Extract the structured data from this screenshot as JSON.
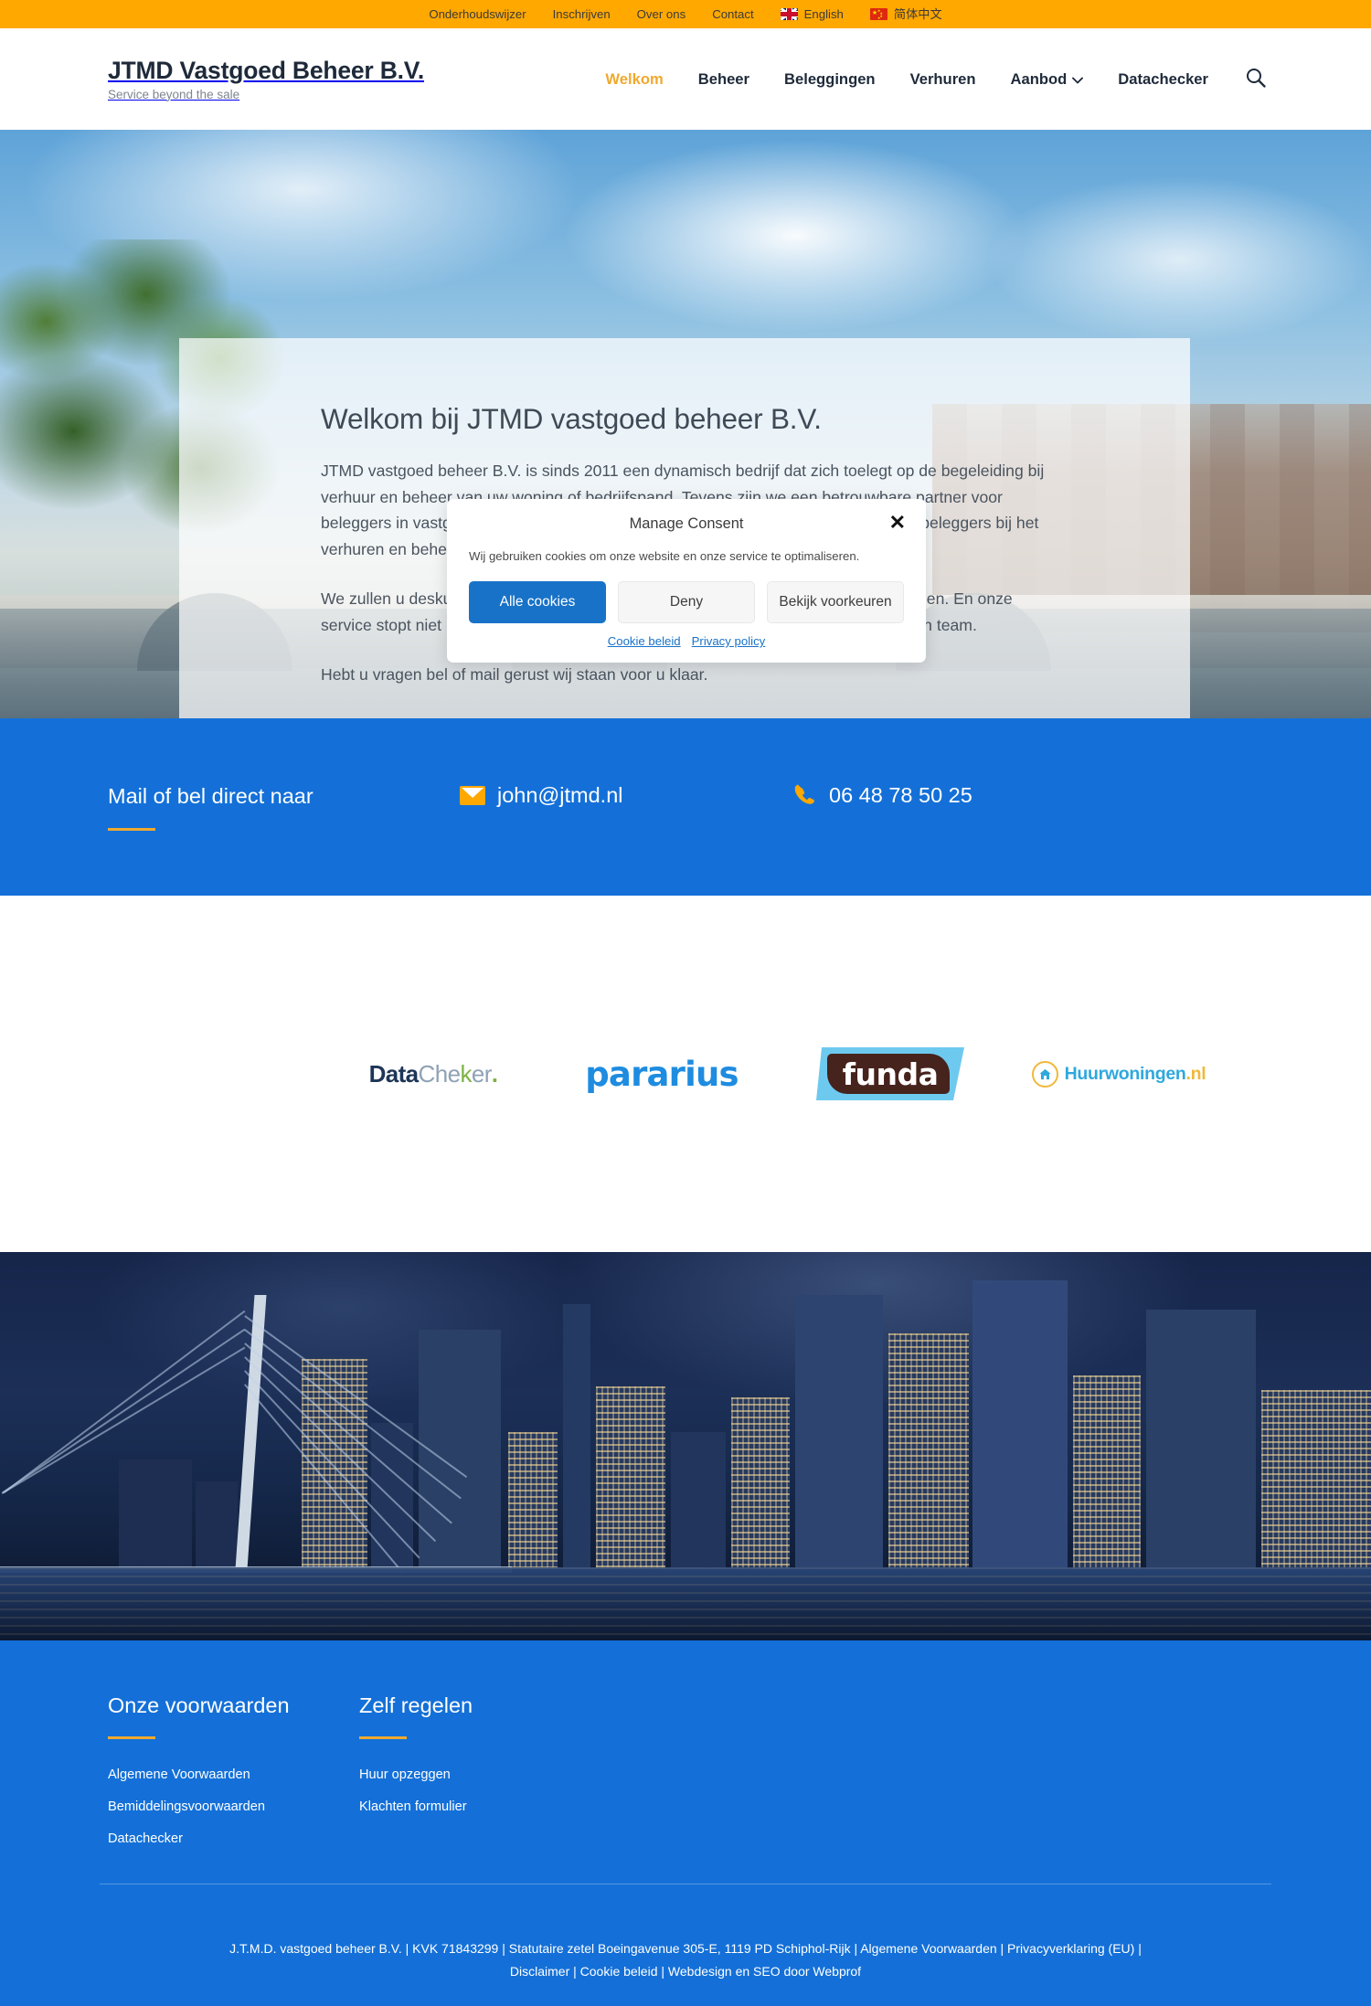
{
  "topbar": {
    "links": [
      {
        "label": "Onderhoudswijzer"
      },
      {
        "label": "Inschrijven"
      },
      {
        "label": "Over ons"
      },
      {
        "label": "Contact"
      }
    ],
    "languages": [
      {
        "label": "English",
        "flag": "uk-flag-icon"
      },
      {
        "label": "简体中文",
        "flag": "china-flag-icon"
      }
    ],
    "background": "#ffa800"
  },
  "header": {
    "brand_title": "JTMD Vastgoed Beheer B.V.",
    "brand_tagline": "Service beyond the sale",
    "nav": [
      {
        "label": "Welkom",
        "active": true
      },
      {
        "label": "Beheer",
        "active": false
      },
      {
        "label": "Beleggingen",
        "active": false
      },
      {
        "label": "Verhuren",
        "active": false
      },
      {
        "label": "Aanbod",
        "active": false,
        "has_dropdown": true
      },
      {
        "label": "Datachecker",
        "active": false
      }
    ],
    "search_icon": "search-icon",
    "accent_color": "#f0a92e"
  },
  "hero": {
    "heading": "Welkom bij JTMD vastgoed beheer B.V.",
    "paragraphs": [
      "JTMD vastgoed beheer B.V. is sinds 2011 een dynamisch bedrijf dat zich toelegt op de begeleiding bij verhuur en beheer van uw woning of bedrijfspand. Tevens zijn we een betrouwbare partner voor beleggers in vastgoed. Met onze jarenlange ervaring begeleiden wij particulieren en beleggers bij het verhuren en beheren van hun onroerend goed. Uw wensen staan bij ons centraal.",
      "We zullen u deskundig adviseren en samen met u de juiste weg uitstippelen en tekenen. En onze service stopt niet na het tekenen van de overeenkomst. U krijgt een vast en betrokken team.",
      "Hebt u vragen bel of mail gerust wij staan voor u klaar."
    ]
  },
  "consent": {
    "title": "Manage Consent",
    "close_icon": "close-icon",
    "description": "Wij gebruiken cookies om onze website en onze service te optimaliseren.",
    "buttons": [
      {
        "label": "Alle cookies",
        "style": "primary"
      },
      {
        "label": "Deny",
        "style": "ghost"
      },
      {
        "label": "Bekijk voorkeuren",
        "style": "ghost"
      }
    ],
    "links": [
      {
        "label": "Cookie beleid"
      },
      {
        "label": "Privacy policy"
      }
    ],
    "primary_color": "#1872c8"
  },
  "contact": {
    "title": "Mail of bel direct naar",
    "email": "john@jtmd.nl",
    "email_icon": "mail-icon",
    "phone": "06 48 78 50 25",
    "phone_icon": "phone-icon",
    "background": "#1470d8",
    "accent": "#f0a92e"
  },
  "partners": [
    {
      "name": "DataChecker",
      "parts": {
        "a": "Data",
        "b": "Che",
        "c": "k",
        "d": "er",
        "e": "."
      }
    },
    {
      "name": "pararius",
      "text": "pararius"
    },
    {
      "name": "funda",
      "text": "funda"
    },
    {
      "name": "Huurwoningen.nl",
      "text": "Huurwoningen",
      "suffix": ".nl"
    }
  ],
  "footer": {
    "columns": [
      {
        "heading": "Onze voorwaarden",
        "links": [
          {
            "label": "Algemene Voorwaarden"
          },
          {
            "label": "Bemiddelingsvoorwaarden"
          },
          {
            "label": "Datachecker"
          }
        ]
      },
      {
        "heading": "Zelf regelen",
        "links": [
          {
            "label": "Huur opzeggen"
          },
          {
            "label": "Klachten formulier"
          }
        ]
      }
    ],
    "copyright": "J.T.M.D. vastgoed beheer B.V. | KVK 71843299 | Statutaire zetel Boeingavenue 305-E, 1119 PD Schiphol-Rijk | Algemene Voorwaarden | Privacyverklaring (EU) | Disclaimer | Cookie beleid | Webdesign en SEO door Webprof",
    "background": "#1470d8"
  }
}
